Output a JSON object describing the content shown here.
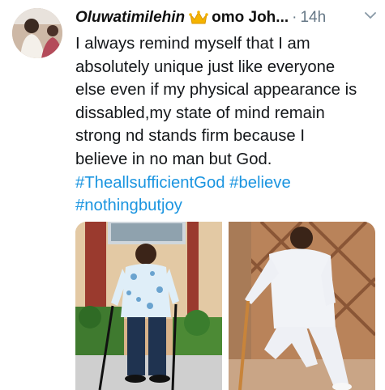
{
  "tweet": {
    "author_name": "Oluwatimilehin",
    "author_badge_emoji": "crown-emoji",
    "author_name_suffix": "omo Joh...",
    "separator": "·",
    "timestamp": "14h",
    "text_lines": [
      "I always remind myself that I am",
      "absolutely unique just like everyone",
      "else even if my physical appearance is",
      "dissabled,my state of mind remain",
      "strong nd stands firm because I",
      "believe in no man but God."
    ],
    "hashtags": [
      "#TheallsufficientGod",
      "#believe",
      "#nothingbutjoy"
    ],
    "media_count": 2
  },
  "colors": {
    "hashtag": "#1b95e0",
    "meta_grey": "#657786",
    "text": "#14171a"
  }
}
